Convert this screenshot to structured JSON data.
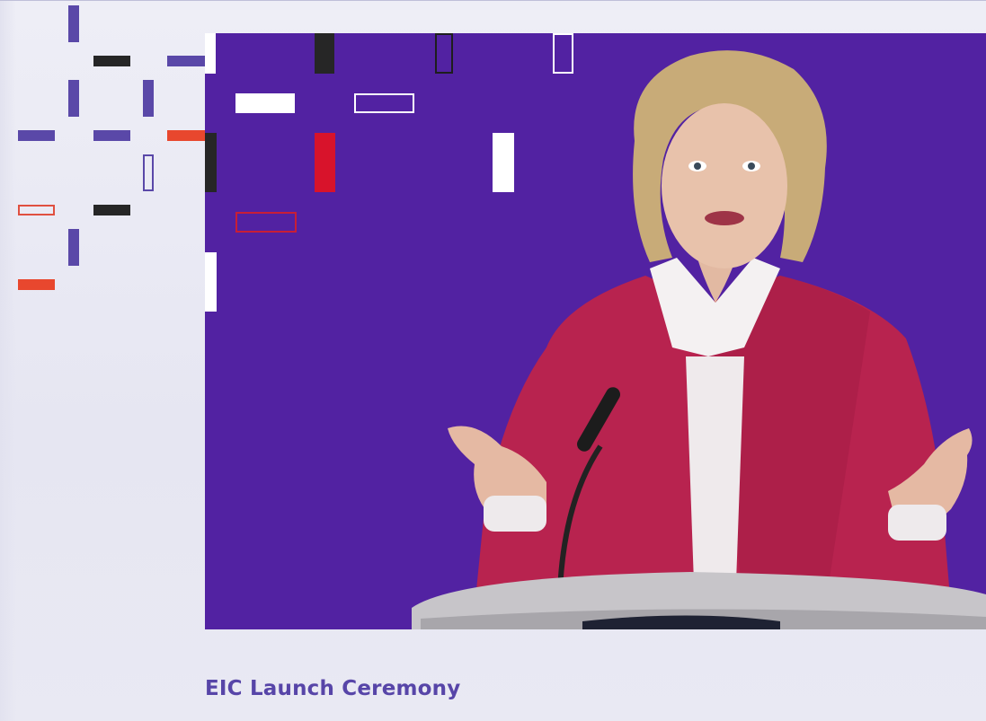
{
  "caption": {
    "title": "EIC Launch Ceremony"
  },
  "video": {
    "subject": "speaker-at-podium",
    "background_color": "#5222a2"
  },
  "colors": {
    "brand_purple": "#5a48a8",
    "accent_red": "#e8472e",
    "dark": "#262626",
    "jacket": "#b8234f",
    "title_text": "#5745a8"
  },
  "decor_icons": [
    "dash-pattern"
  ]
}
